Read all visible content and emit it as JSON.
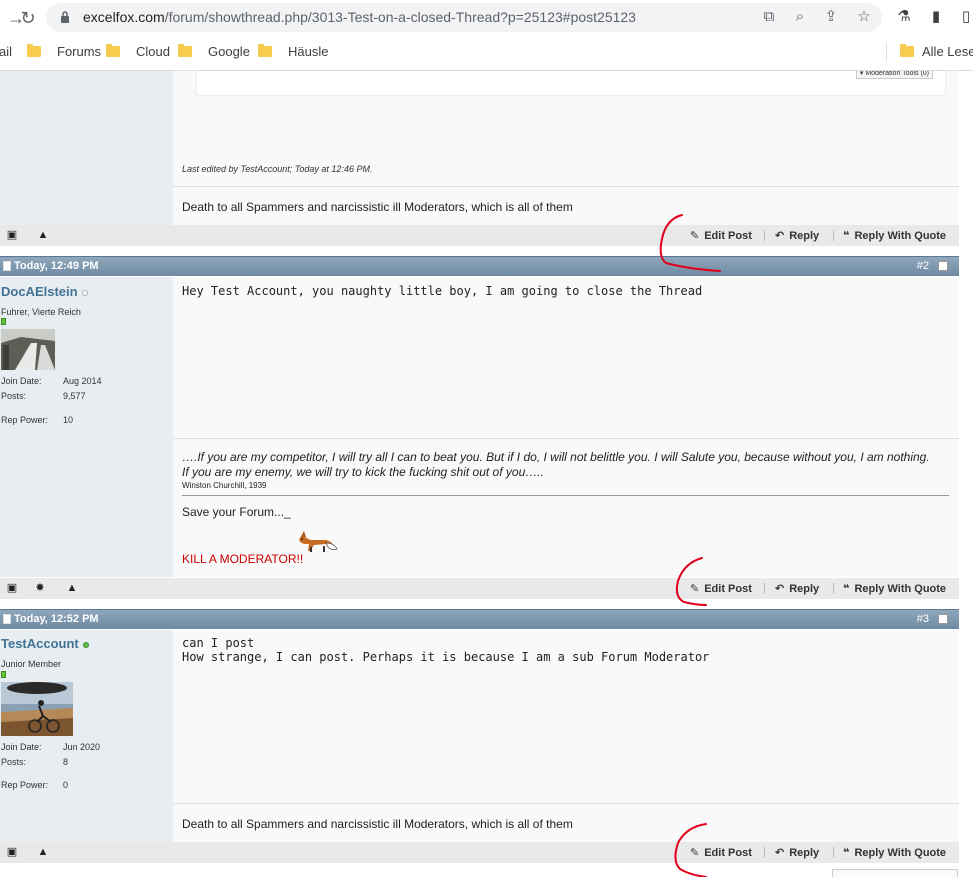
{
  "browser": {
    "url_host": "excelfox.com",
    "url_path": "/forum/showthread.php/3013-Test-on-a-closed-Thread?p=25123#post25123",
    "bookmarks": [
      {
        "label": "ail"
      },
      {
        "label": "Forums"
      },
      {
        "label": "Cloud"
      },
      {
        "label": "Google"
      },
      {
        "label": "Häusle"
      },
      {
        "label": "Alle Lesez"
      }
    ]
  },
  "post1": {
    "mod_tools": "▾ Moderation Tools (0)",
    "last_edited": "Last edited by TestAccount; Today at 12:46 PM.",
    "signature": "Death to all Spammers and narcissistic ill Moderators, which is all of them"
  },
  "actions": {
    "edit": "Edit Post",
    "reply": "Reply",
    "quote": "Reply With Quote"
  },
  "post2": {
    "date": "Today, 12:49 PM",
    "number": "#2",
    "username": "DocAElstein",
    "user_title": "Fuhrer, Vierte Reich",
    "join_label": "Join Date:",
    "join_value": "Aug 2014",
    "posts_label": "Posts:",
    "posts_value": "9,577",
    "rep_label": "Rep Power:",
    "rep_value": "10",
    "message": "Hey Test Account, you naughty little boy, I am going to close the Thread",
    "sig_line1": "….If you are my competitor, I will try all I can to beat you. But if I do, I will not belittle you. I will Salute you, because without you, I am nothing.",
    "sig_line2": "If you are my enemy, we will try to kick the fucking shit out of you…..",
    "sig_author": "Winston Churchill, 1939",
    "sig_save": "Save your Forum..._",
    "sig_kill": "KILL A MODERATOR!!"
  },
  "post3": {
    "date": "Today, 12:52 PM",
    "number": "#3",
    "username": "TestAccount",
    "user_title": "Junior Member",
    "join_label": "Join Date:",
    "join_value": "Jun 2020",
    "posts_label": "Posts:",
    "posts_value": "8",
    "rep_label": "Rep Power:",
    "rep_value": "0",
    "message_line1": "can I post",
    "message_line2": "How strange, I can post. Perhaps it is because I am a sub Forum Moderator",
    "signature": "Death to all Spammers and narcissistic ill Moderators, which is all of them"
  },
  "colors": {
    "header_blue": "#7893ab",
    "username_blue": "#417394",
    "red_annotation": "#e0001a",
    "kill_red": "#cc0000"
  }
}
